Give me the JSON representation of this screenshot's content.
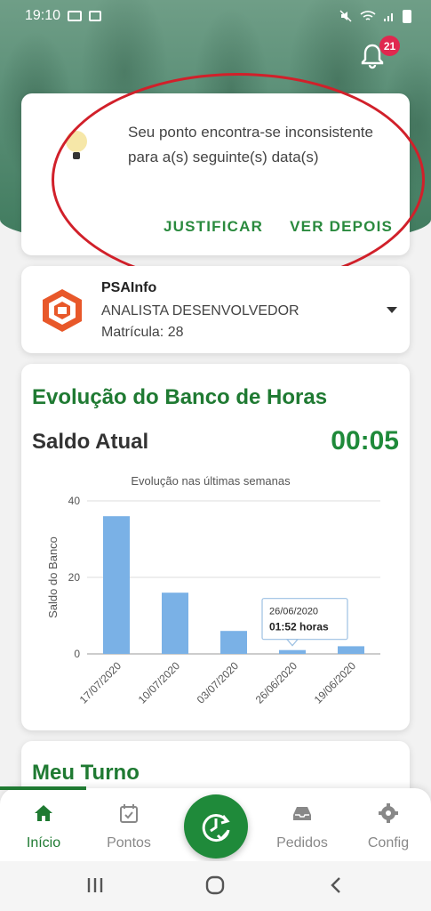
{
  "status_bar": {
    "time": "19:10"
  },
  "notifications": {
    "count": "21"
  },
  "alert": {
    "message": "Seu ponto encontra-se inconsistente para a(s) seguinte(s) data(s)",
    "justify_label": "JUSTIFICAR",
    "later_label": "VER DEPOIS"
  },
  "company": {
    "name": "PSAInfo",
    "role": "ANALISTA DESENVOLVEDOR",
    "registration": "Matrícula: 28"
  },
  "bank": {
    "title": "Evolução do Banco de Horas",
    "balance_label": "Saldo Atual",
    "balance_value": "00:05"
  },
  "chart_data": {
    "type": "bar",
    "title": "Evolução nas últimas semanas",
    "ylabel": "Saldo do Banco",
    "xlabel": "",
    "categories": [
      "17/07/2020",
      "10/07/2020",
      "03/07/2020",
      "26/06/2020",
      "19/06/2020"
    ],
    "values": [
      36,
      16,
      6,
      1,
      2
    ],
    "ylim": [
      0,
      40
    ],
    "yticks": [
      0,
      20,
      40
    ],
    "grid": true,
    "bar_color": "#7ab1e6",
    "tooltip": {
      "date": "26/06/2020",
      "value": "01:52 horas",
      "category_index": 3
    }
  },
  "shift": {
    "title": "Meu Turno"
  },
  "nav": {
    "items": [
      {
        "label": "Início",
        "icon": "home-icon"
      },
      {
        "label": "Pontos",
        "icon": "calendar-check-icon"
      },
      {
        "label": "Pedidos",
        "icon": "inbox-icon"
      },
      {
        "label": "Config",
        "icon": "gear-icon"
      }
    ],
    "active_color": "#1f7a32",
    "fab_icon": "clock-check-icon"
  },
  "colors": {
    "accent": "#1f8a3a",
    "annotation": "#d1202a",
    "badge": "#e0284f"
  }
}
